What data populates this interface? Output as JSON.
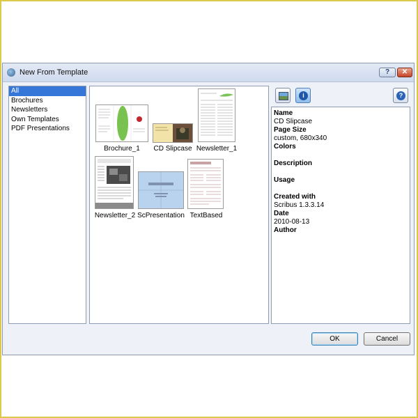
{
  "window": {
    "title": "New From Template",
    "help_glyph": "?",
    "close_glyph": "✕"
  },
  "categories": [
    "All",
    "Brochures",
    "Newsletters",
    "Own Templates",
    "PDF Presentations"
  ],
  "templates": [
    {
      "label": "Brochure_1"
    },
    {
      "label": "CD Slipcase"
    },
    {
      "label": "Newsletter_1"
    },
    {
      "label": "Newsletter_2"
    },
    {
      "label": "ScPresentation"
    },
    {
      "label": "TextBased"
    }
  ],
  "info": {
    "name_label": "Name",
    "name_value": "CD Slipcase",
    "page_size_label": "Page Size",
    "page_size_value": "custom, 680x340",
    "colors_label": "Colors",
    "description_label": "Description",
    "usage_label": "Usage",
    "created_with_label": "Created with",
    "created_with_value": "Scribus 1.3.3.14",
    "date_label": "Date",
    "date_value": "2010-08-13",
    "author_label": "Author"
  },
  "buttons": {
    "ok": "OK",
    "cancel": "Cancel"
  }
}
